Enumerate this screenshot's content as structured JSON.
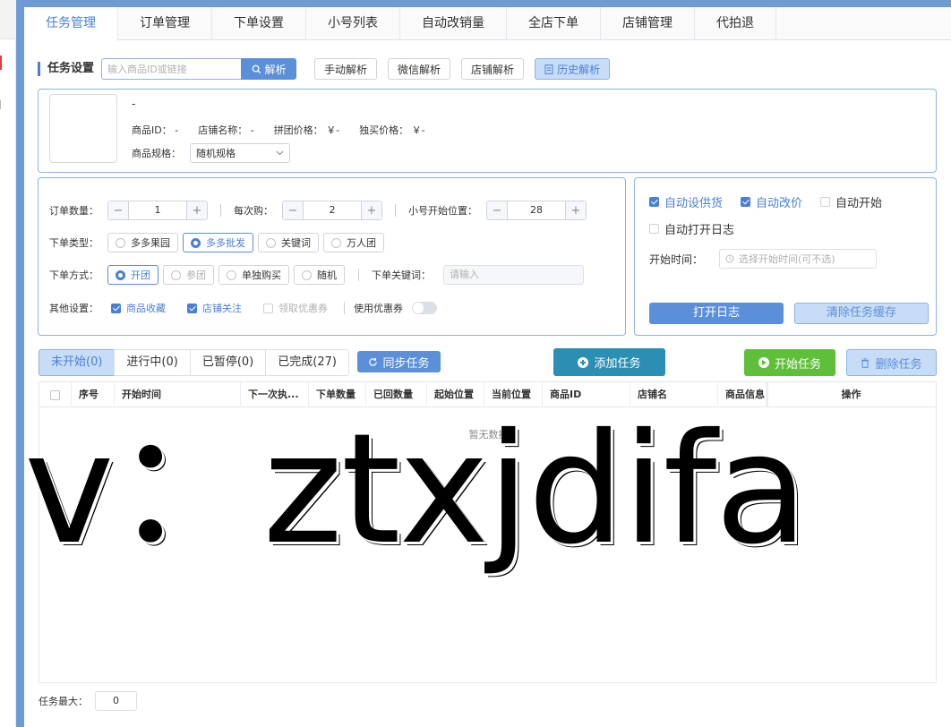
{
  "tabs": [
    "任务管理",
    "订单管理",
    "下单设置",
    "小号列表",
    "自动改销量",
    "全店下单",
    "店铺管理",
    "代拍退"
  ],
  "settings": {
    "title": "任务设置",
    "search_placeholder": "输入商品ID或链接",
    "parse_label": "解析",
    "manual_parse": "手动解析",
    "wechat_parse": "微信解析",
    "shop_parse": "店铺解析",
    "history_parse": "历史解析"
  },
  "product": {
    "name": "-",
    "id_label": "商品ID：",
    "id_value": "-",
    "shop_label": "店铺名称：",
    "shop_value": "-",
    "group_price_label": "拼团价格：",
    "group_price_value": "￥-",
    "single_price_label": "独买价格：",
    "single_price_value": "￥-",
    "spec_label": "商品规格：",
    "spec_value": "随机规格"
  },
  "order": {
    "qty_label": "订单数量：",
    "qty_value": "1",
    "per_buy_label": "每次购：",
    "per_buy_value": "2",
    "start_pos_label": "小号开始位置：",
    "start_pos_value": "28",
    "type_label": "下单类型：",
    "types": [
      "多多果园",
      "多多批发",
      "关键词",
      "万人团"
    ],
    "selected_type": 1,
    "method_label": "下单方式：",
    "methods": [
      "开团",
      "参团",
      "单独购买",
      "随机"
    ],
    "selected_method": 0,
    "keyword_label": "下单关键词：",
    "keyword_placeholder": "请输入",
    "other_label": "其他设置：",
    "fav_product": "商品收藏",
    "follow_shop": "店铺关注",
    "get_coupon": "领取优惠券",
    "use_coupon": "使用优惠券"
  },
  "auto": {
    "auto_supply": "自动设供货",
    "auto_price": "自动改价",
    "auto_start": "自动开始",
    "auto_log": "自动打开日志",
    "start_time_label": "开始时间：",
    "start_time_placeholder": "选择开始时间(可不选)",
    "open_log": "打开日志",
    "clear_cache": "清除任务缓存"
  },
  "status_tabs": [
    "未开始(0)",
    "进行中(0)",
    "已暂停(0)",
    "已完成(27)"
  ],
  "actions": {
    "sync": "同步任务",
    "add": "添加任务",
    "start": "开始任务",
    "delete": "删除任务"
  },
  "table": {
    "columns": [
      "序号",
      "开始时间",
      "下一次执...",
      "下单数量",
      "已回数量",
      "起始位置",
      "当前位置",
      "商品ID",
      "店铺名",
      "商品信息",
      "操作"
    ],
    "empty_text": "暂无数据"
  },
  "footer": {
    "max_label": "任务最大：",
    "max_value": "0"
  },
  "watermark": "v：ztxjdifa",
  "colors": {
    "accent": "#4a7fd6",
    "border_blue": "#8fb1e3",
    "add_button": "#2b8fb3",
    "start_button": "#5fbf3a"
  }
}
